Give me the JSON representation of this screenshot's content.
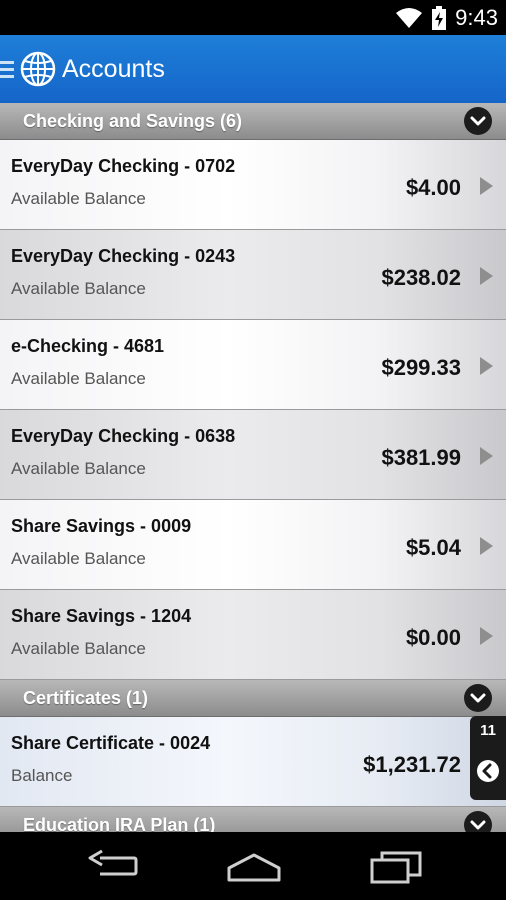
{
  "status_bar": {
    "time": "9:43"
  },
  "app_bar": {
    "title": "Accounts"
  },
  "sections": [
    {
      "title": "Checking and Savings (6)"
    },
    {
      "title": "Certificates (1)"
    },
    {
      "title": "Education IRA Plan (1)"
    }
  ],
  "accounts": [
    {
      "name": "EveryDay Checking - 0702",
      "label": "Available Balance",
      "amount": "$4.00"
    },
    {
      "name": "EveryDay Checking - 0243",
      "label": "Available Balance",
      "amount": "$238.02"
    },
    {
      "name": "e-Checking - 4681",
      "label": "Available Balance",
      "amount": "$299.33"
    },
    {
      "name": "EveryDay Checking - 0638",
      "label": "Available Balance",
      "amount": "$381.99"
    },
    {
      "name": "Share Savings - 0009",
      "label": "Available Balance",
      "amount": "$5.04"
    },
    {
      "name": "Share Savings - 1204",
      "label": "Available Balance",
      "amount": "$0.00"
    },
    {
      "name": "Share Certificate - 0024",
      "label": "Balance",
      "amount": "$1,231.72"
    }
  ],
  "side_tab": {
    "count": "11"
  },
  "icons": {
    "menu": "menu-icon",
    "globe": "globe-icon",
    "wifi": "wifi-icon",
    "battery": "battery-icon",
    "collapse": "chevron-down-icon",
    "row": "chevron-right-icon",
    "side": "chevron-left-icon",
    "back": "back-icon",
    "home": "home-icon",
    "recents": "recents-icon"
  },
  "colors": {
    "app_bar": "#1565c9",
    "section_header": "#9a9a9a",
    "accent_text": "#111111"
  }
}
